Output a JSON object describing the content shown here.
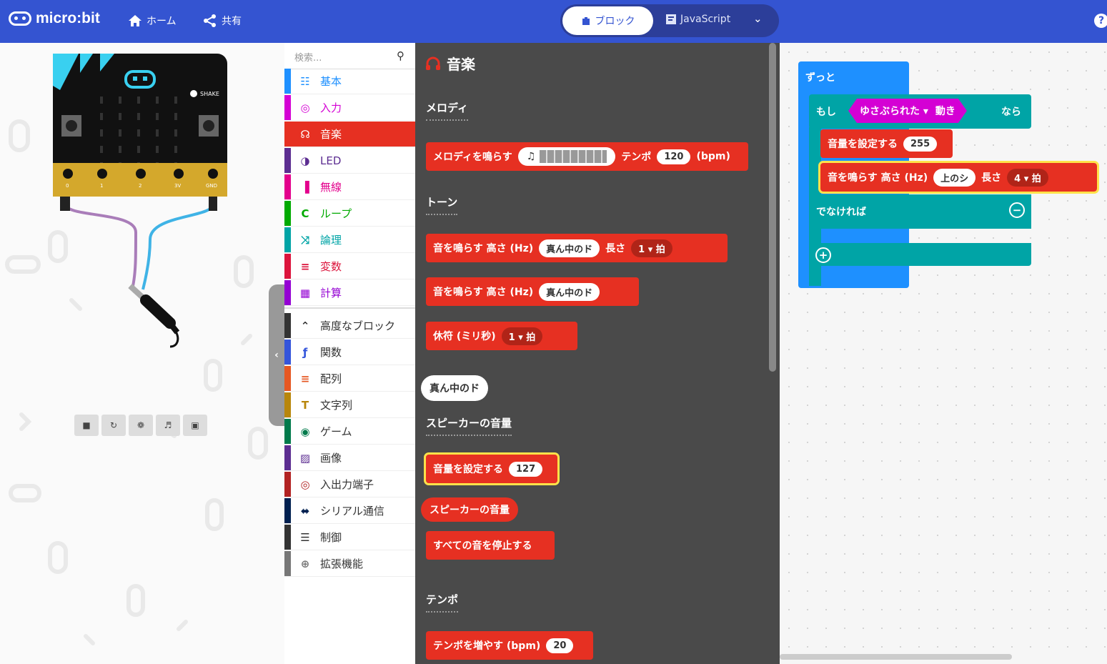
{
  "header": {
    "logo": "micro:bit",
    "home_label": "ホーム",
    "share_label": "共有",
    "blocks_tab": "ブロック",
    "js_tab": "JavaScript",
    "help_icon": "?"
  },
  "simulator": {
    "shake_label": "SHAKE",
    "pins": [
      "0",
      "1",
      "2",
      "3V",
      "GND"
    ],
    "controls": [
      "stop",
      "restart",
      "debug",
      "mute",
      "fullscreen"
    ]
  },
  "toolbox": {
    "search_placeholder": "検索...",
    "categories": [
      {
        "label": "基本",
        "color": "#1E90FF",
        "icon": "grid-icon"
      },
      {
        "label": "入力",
        "color": "#D400D4",
        "icon": "target-icon"
      },
      {
        "label": "音楽",
        "color": "#E63022",
        "icon": "headphones-icon",
        "selected": true
      },
      {
        "label": "LED",
        "color": "#5C2D91",
        "icon": "toggle-icon"
      },
      {
        "label": "無線",
        "color": "#E3008C",
        "icon": "signal-icon"
      },
      {
        "label": "ループ",
        "color": "#00AA00",
        "icon": "refresh-icon"
      },
      {
        "label": "論理",
        "color": "#00A4A6",
        "icon": "shuffle-icon"
      },
      {
        "label": "変数",
        "color": "#DC143C",
        "icon": "list-icon"
      },
      {
        "label": "計算",
        "color": "#9400D3",
        "icon": "calculator-icon"
      },
      {
        "label": "高度なブロック",
        "color": "#333333",
        "icon": "chevron-up-icon"
      },
      {
        "label": "関数",
        "color": "#3455DB",
        "icon": "function-icon"
      },
      {
        "label": "配列",
        "color": "#E65722",
        "icon": "list-icon"
      },
      {
        "label": "文字列",
        "color": "#B8860B",
        "icon": "text-icon"
      },
      {
        "label": "ゲーム",
        "color": "#007A4B",
        "icon": "gamepad-icon"
      },
      {
        "label": "画像",
        "color": "#5C2D91",
        "icon": "image-icon"
      },
      {
        "label": "入出力端子",
        "color": "#B22222",
        "icon": "pin-icon"
      },
      {
        "label": "シリアル通信",
        "color": "#002050",
        "icon": "usb-icon"
      },
      {
        "label": "制御",
        "color": "#333333",
        "icon": "control-icon"
      },
      {
        "label": "拡張機能",
        "color": "#777777",
        "icon": "plus-circle-icon"
      }
    ]
  },
  "flyout": {
    "title": "音楽",
    "sections": {
      "melody": "メロディ",
      "tone": "トーン",
      "volume": "スピーカーの音量",
      "tempo": "テンポ"
    },
    "blocks": {
      "play_melody": {
        "text": "メロディを鳴らす",
        "tempo_label": "テンポ",
        "tempo": "120",
        "unit": "(bpm)"
      },
      "play_tone": {
        "text": "音を鳴らす 高さ (Hz)",
        "note": "真ん中のド",
        "length_label": "長さ",
        "beat": "1",
        "beat_unit": "拍"
      },
      "ring_tone": {
        "text": "音を鳴らす 高さ (Hz)",
        "note": "真ん中のド"
      },
      "rest": {
        "text": "休符 (ミリ秒)",
        "beat": "1",
        "beat_unit": "拍"
      },
      "note_reporter": "真ん中のド",
      "set_volume": {
        "text": "音量を設定する",
        "value": "127"
      },
      "volume_reporter": "スピーカーの音量",
      "stop_all": "すべての音を停止する",
      "change_tempo": {
        "text": "テンポを増やす (bpm)",
        "value": "20"
      }
    }
  },
  "workspace": {
    "forever": "ずっと",
    "if_label": "もし",
    "then_label": "なら",
    "event": "ゆさぶられた",
    "event_suffix": "動き",
    "set_volume": {
      "text": "音量を設定する",
      "value": "255"
    },
    "play_tone": {
      "text": "音を鳴らす 高さ (Hz)",
      "note": "上のシ",
      "length_label": "長さ",
      "beat": "4",
      "beat_unit": "拍"
    },
    "else_label": "でなければ"
  }
}
